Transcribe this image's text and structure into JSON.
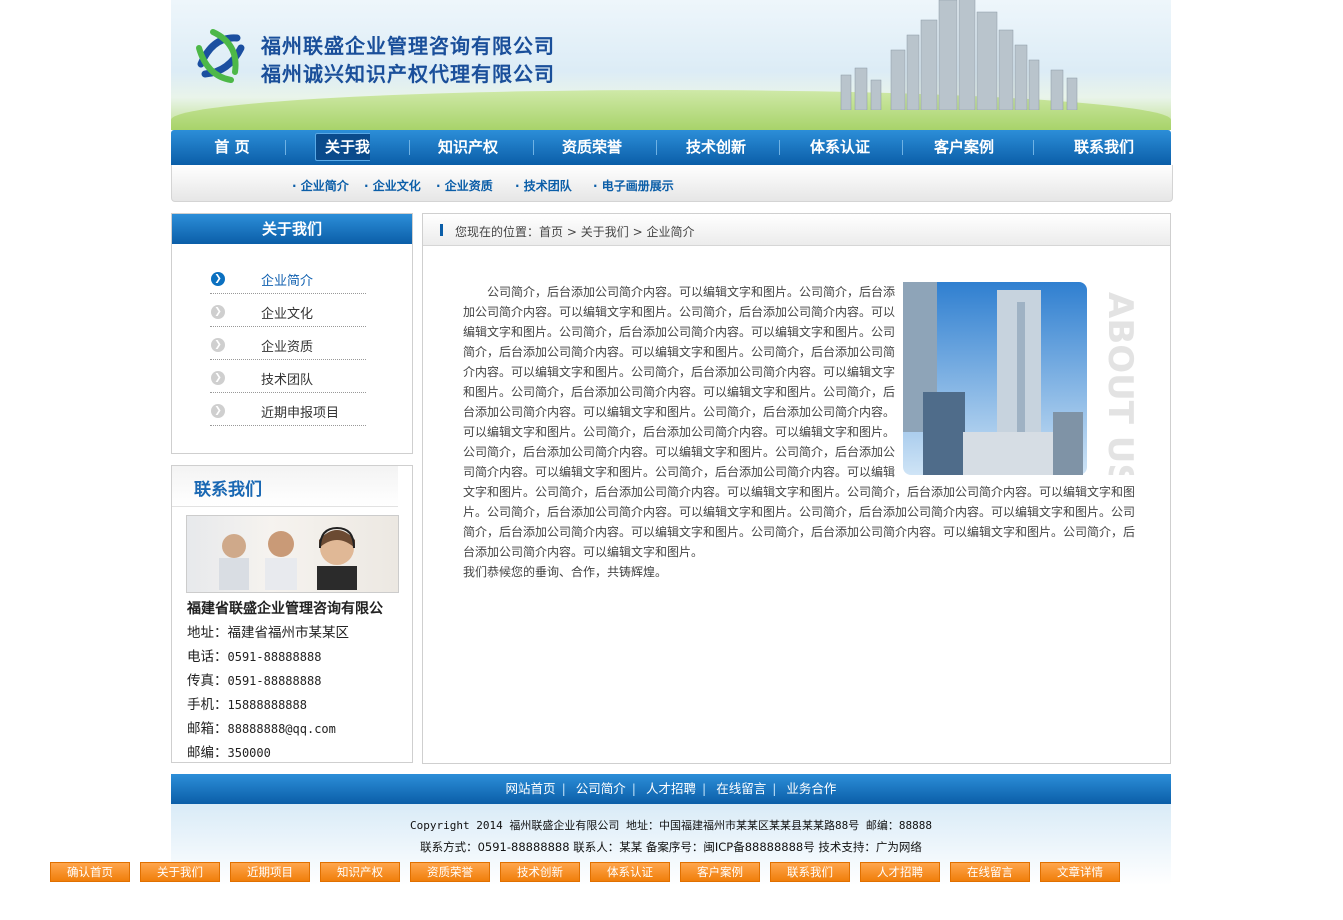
{
  "header": {
    "company_line1": "福州联盛企业管理咨询有限公司",
    "company_line2": "福州诚兴知识产权代理有限公司"
  },
  "nav": {
    "items": [
      "首 页",
      "关于我们",
      "知识产权",
      "资质荣誉",
      "技术创新",
      "体系认证",
      "客户案例",
      "联系我们"
    ],
    "active": "关于我们"
  },
  "subnav": {
    "items": [
      "· 企业简介",
      "· 企业文化",
      "· 企业资质",
      "· 技术团队",
      "· 电子画册展示"
    ]
  },
  "sidebar": {
    "title": "关于我们",
    "items": [
      "企业简介",
      "企业文化",
      "企业资质",
      "技术团队",
      "近期申报项目"
    ],
    "active": "企业简介"
  },
  "contact": {
    "title": "联系我们",
    "company": "福建省联盛企业管理咨询有限公",
    "address_label": "地址：",
    "address": "福建省福州市某某区",
    "phone_label": "电话：",
    "phone": "0591-88888888",
    "fax_label": "传真：",
    "fax": "0591-88888888",
    "mobile_label": "手机：",
    "mobile": "15888888888",
    "email_label": "邮箱：",
    "email": "88888888@qq.com",
    "zip_label": "邮编：",
    "zip": "350000"
  },
  "breadcrumb": {
    "prefix": "您现在的位置：",
    "home": "首页",
    "section": "关于我们",
    "page": "企业简介",
    "sep": ">"
  },
  "article": {
    "image_watermark": "ABOUT US",
    "body": "公司简介，后台添加公司简介内容。可以编辑文字和图片。公司简介，后台添加公司简介内容。可以编辑文字和图片。公司简介，后台添加公司简介内容。可以编辑文字和图片。公司简介，后台添加公司简介内容。可以编辑文字和图片。公司简介，后台添加公司简介内容。可以编辑文字和图片。公司简介，后台添加公司简介内容。可以编辑文字和图片。公司简介，后台添加公司简介内容。可以编辑文字和图片。公司简介，后台添加公司简介内容。可以编辑文字和图片。公司简介，后台添加公司简介内容。可以编辑文字和图片。公司简介，后台添加公司简介内容。可以编辑文字和图片。公司简介，后台添加公司简介内容。可以编辑文字和图片。公司简介，后台添加公司简介内容。可以编辑文字和图片。公司简介，后台添加公司简介内容。可以编辑文字和图片。公司简介，后台添加公司简介内容。可以编辑文字和图片。公司简介，后台添加公司简介内容。可以编辑文字和图片。公司简介，后台添加公司简介内容。可以编辑文字和图片。公司简介，后台添加公司简介内容。可以编辑文字和图片。公司简介，后台添加公司简介内容。可以编辑文字和图片。公司简介，后台添加公司简介内容。可以编辑文字和图片。公司简介，后台添加公司简介内容。可以编辑文字和图片。公司简介，后台添加公司简介内容。可以编辑文字和图片。",
    "closing": "我们恭候您的垂询、合作，共铸辉煌。"
  },
  "footer": {
    "links": [
      "网站首页",
      "公司简介",
      "人才招聘",
      "在线留言",
      "业务合作"
    ],
    "copyright_line": "Copyright 2014  福州联盛企业有限公司  地址：中国福建福州市某某区某某县某某路88号  邮编：88888",
    "contact_line": "联系方式：0591-88888888  联系人：某某  备案序号：闽ICP备88888888号  技术支持：广为网络"
  },
  "quickbar": {
    "items": [
      "确认首页",
      "关于我们",
      "近期项目",
      "知识产权",
      "资质荣誉",
      "技术创新",
      "体系认证",
      "客户案例",
      "联系我们",
      "人才招聘",
      "在线留言",
      "文章详情"
    ]
  },
  "colors": {
    "primary_blue": "#0b5ea8",
    "accent_orange": "#f07e0a"
  }
}
